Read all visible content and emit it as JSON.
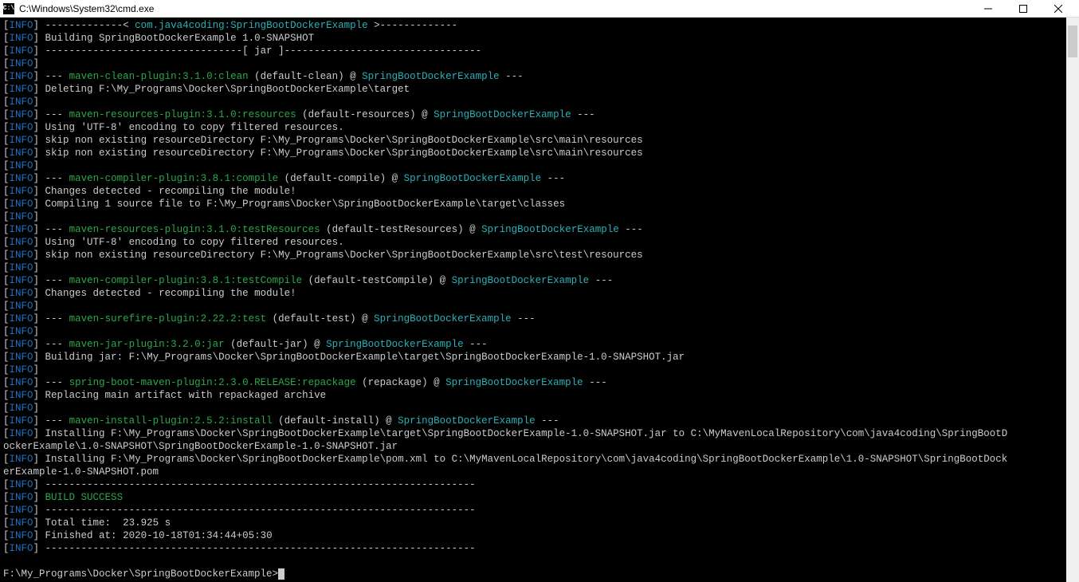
{
  "titlebar": {
    "icon_label": "C:\\",
    "title": "C:\\Windows\\System32\\cmd.exe"
  },
  "t": {
    "lb": "[",
    "rb": "]",
    "info": "INFO",
    "dash_header": " -------------< ",
    "dash_header_end": " >-------------",
    "gav": "com.java4coding:SpringBootDockerExample",
    "building": " Building SpringBootDockerExample 1.0-SNAPSHOT",
    "jar_rule": " ---------------------------------[ jar ]---------------------------------",
    "dashes3pre": " --- ",
    "sep72": " ------------------------------------------------------------------------",
    "clean_plugin": "maven-clean-plugin:3.1.0:clean",
    "clean_goal": " (default-clean) @ ",
    "dash3post": " ---",
    "artifact": "SpringBootDockerExample",
    "deleting": " Deleting F:\\My_Programs\\Docker\\SpringBootDockerExample\\target",
    "resources_plugin": "maven-resources-plugin:3.1.0:resources",
    "resources_goal": " (default-resources) @ ",
    "utf8": " Using 'UTF-8' encoding to copy filtered resources.",
    "skip_main1": " skip non existing resourceDirectory F:\\My_Programs\\Docker\\SpringBootDockerExample\\src\\main\\resources",
    "skip_main2": " skip non existing resourceDirectory F:\\My_Programs\\Docker\\SpringBootDockerExample\\src\\main\\resources",
    "compiler_plugin": "maven-compiler-plugin:3.8.1:compile",
    "compiler_goal": " (default-compile) @ ",
    "changes": " Changes detected - recompiling the module!",
    "compiling": " Compiling 1 source file to F:\\My_Programs\\Docker\\SpringBootDockerExample\\target\\classes",
    "testres_plugin": "maven-resources-plugin:3.1.0:testResources",
    "testres_goal": " (default-testResources) @ ",
    "skip_test": " skip non existing resourceDirectory F:\\My_Programs\\Docker\\SpringBootDockerExample\\src\\test\\resources",
    "testcompile_plugin": "maven-compiler-plugin:3.8.1:testCompile",
    "testcompile_goal": " (default-testCompile) @ ",
    "surefire_plugin": "maven-surefire-plugin:2.22.2:test",
    "surefire_goal": " (default-test) @ ",
    "jar_plugin": "maven-jar-plugin:3.2.0:jar",
    "jar_goal": " (default-jar) @ ",
    "building_jar": " Building jar: F:\\My_Programs\\Docker\\SpringBootDockerExample\\target\\SpringBootDockerExample-1.0-SNAPSHOT.jar",
    "boot_plugin": "spring-boot-maven-plugin:2.3.0.RELEASE:repackage",
    "boot_goal": " (repackage) @ ",
    "replacing": " Replacing main artifact with repackaged archive",
    "install_plugin": "maven-install-plugin:2.5.2:install",
    "install_goal": " (default-install) @ ",
    "install1": " Installing F:\\My_Programs\\Docker\\SpringBootDockerExample\\target\\SpringBootDockerExample-1.0-SNAPSHOT.jar to C:\\MyMavenLocalRepository\\com\\java4coding\\SpringBootD",
    "install1b": "ockerExample\\1.0-SNAPSHOT\\SpringBootDockerExample-1.0-SNAPSHOT.jar",
    "install2": " Installing F:\\My_Programs\\Docker\\SpringBootDockerExample\\pom.xml to C:\\MyMavenLocalRepository\\com\\java4coding\\SpringBootDockerExample\\1.0-SNAPSHOT\\SpringBootDock",
    "install2b": "erExample-1.0-SNAPSHOT.pom",
    "build_success": " BUILD SUCCESS",
    "total_time": " Total time:  23.925 s",
    "finished_at": " Finished at: 2020-10-18T01:34:44+05:30",
    "prompt": "F:\\My_Programs\\Docker\\SpringBootDockerExample>"
  }
}
